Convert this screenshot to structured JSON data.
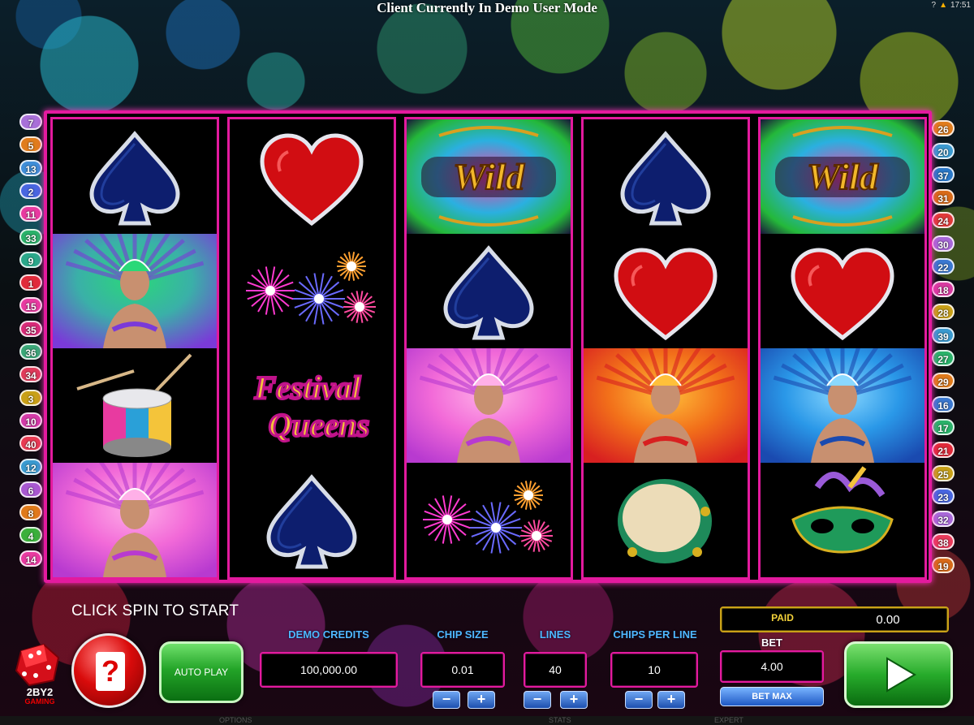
{
  "window": {
    "title": "Client Currently In Demo User Mode",
    "tray_time": "17:51",
    "tray_help": "?"
  },
  "game": {
    "logo_line": "Festival",
    "logo_line2": "Queens",
    "wild_label": "Wild",
    "status_message": "CLICK SPIN TO START"
  },
  "paylines": {
    "left": [
      "7",
      "5",
      "13",
      "2",
      "11",
      "33",
      "9",
      "1",
      "15",
      "35",
      "36",
      "34",
      "3",
      "10",
      "40",
      "12",
      "6",
      "8",
      "4",
      "14"
    ],
    "right": [
      "26",
      "20",
      "37",
      "31",
      "24",
      "30",
      "22",
      "18",
      "28",
      "39",
      "27",
      "29",
      "16",
      "17",
      "21",
      "25",
      "23",
      "32",
      "38",
      "19"
    ],
    "colors": {
      "7": "#a870d8",
      "5": "#e07c1c",
      "13": "#3f8ed8",
      "2": "#4866e0",
      "11": "#e83aa0",
      "33": "#2ab26a",
      "9": "#2aa88a",
      "1": "#e02a3a",
      "15": "#e83aa0",
      "35": "#d82a78",
      "36": "#3aa878",
      "34": "#e03a5a",
      "3": "#c8a018",
      "10": "#d43aa8",
      "40": "#e83a52",
      "12": "#3a9ad0",
      "6": "#a858d0",
      "8": "#e07a1a",
      "4": "#3ab03a",
      "14": "#e83aa0",
      "26": "#e07c1c",
      "20": "#3a9ad0",
      "37": "#2a78c8",
      "31": "#d86a18",
      "24": "#e03a3a",
      "30": "#a868d8",
      "22": "#3a78d0",
      "18": "#d83aa0",
      "28": "#c8a018",
      "39": "#3a9ad0",
      "27": "#2ab26a",
      "29": "#e07a1a",
      "16": "#3a78d0",
      "17": "#2ab26a",
      "21": "#e02a3a",
      "25": "#c8a018",
      "23": "#4866e0",
      "32": "#a868d8",
      "38": "#e83a5a",
      "19": "#d86a18"
    }
  },
  "controls": {
    "demo_credits_label": "DEMO CREDITS",
    "demo_credits_value": "100,000.00",
    "chip_size_label": "CHIP SIZE",
    "chip_size_value": "0.01",
    "lines_label": "LINES",
    "lines_value": "40",
    "chips_per_line_label": "CHIPS PER LINE",
    "chips_per_line_value": "10",
    "paid_label": "PAID",
    "paid_value": "0.00",
    "bet_label": "BET",
    "bet_value": "4.00",
    "bet_max_label": "BET MAX",
    "autoplay_label": "AUTO PLAY",
    "help_symbol": "?",
    "minus": "−",
    "plus": "+"
  },
  "branding": {
    "logo_text": "2BY2",
    "logo_sub": "GAMING"
  },
  "footer": {
    "options": "OPTIONS",
    "stats": "STATS",
    "expert": "EXPERT"
  },
  "reels": [
    [
      "spade",
      "queen-green",
      "drum",
      "queen-pink"
    ],
    [
      "heart",
      "fireworks",
      "festival-logo",
      "spade"
    ],
    [
      "wild",
      "spade",
      "queen-pink",
      "fireworks"
    ],
    [
      "spade",
      "heart",
      "queen-orange",
      "tambourine"
    ],
    [
      "wild",
      "heart",
      "queen-blue",
      "mask"
    ]
  ]
}
